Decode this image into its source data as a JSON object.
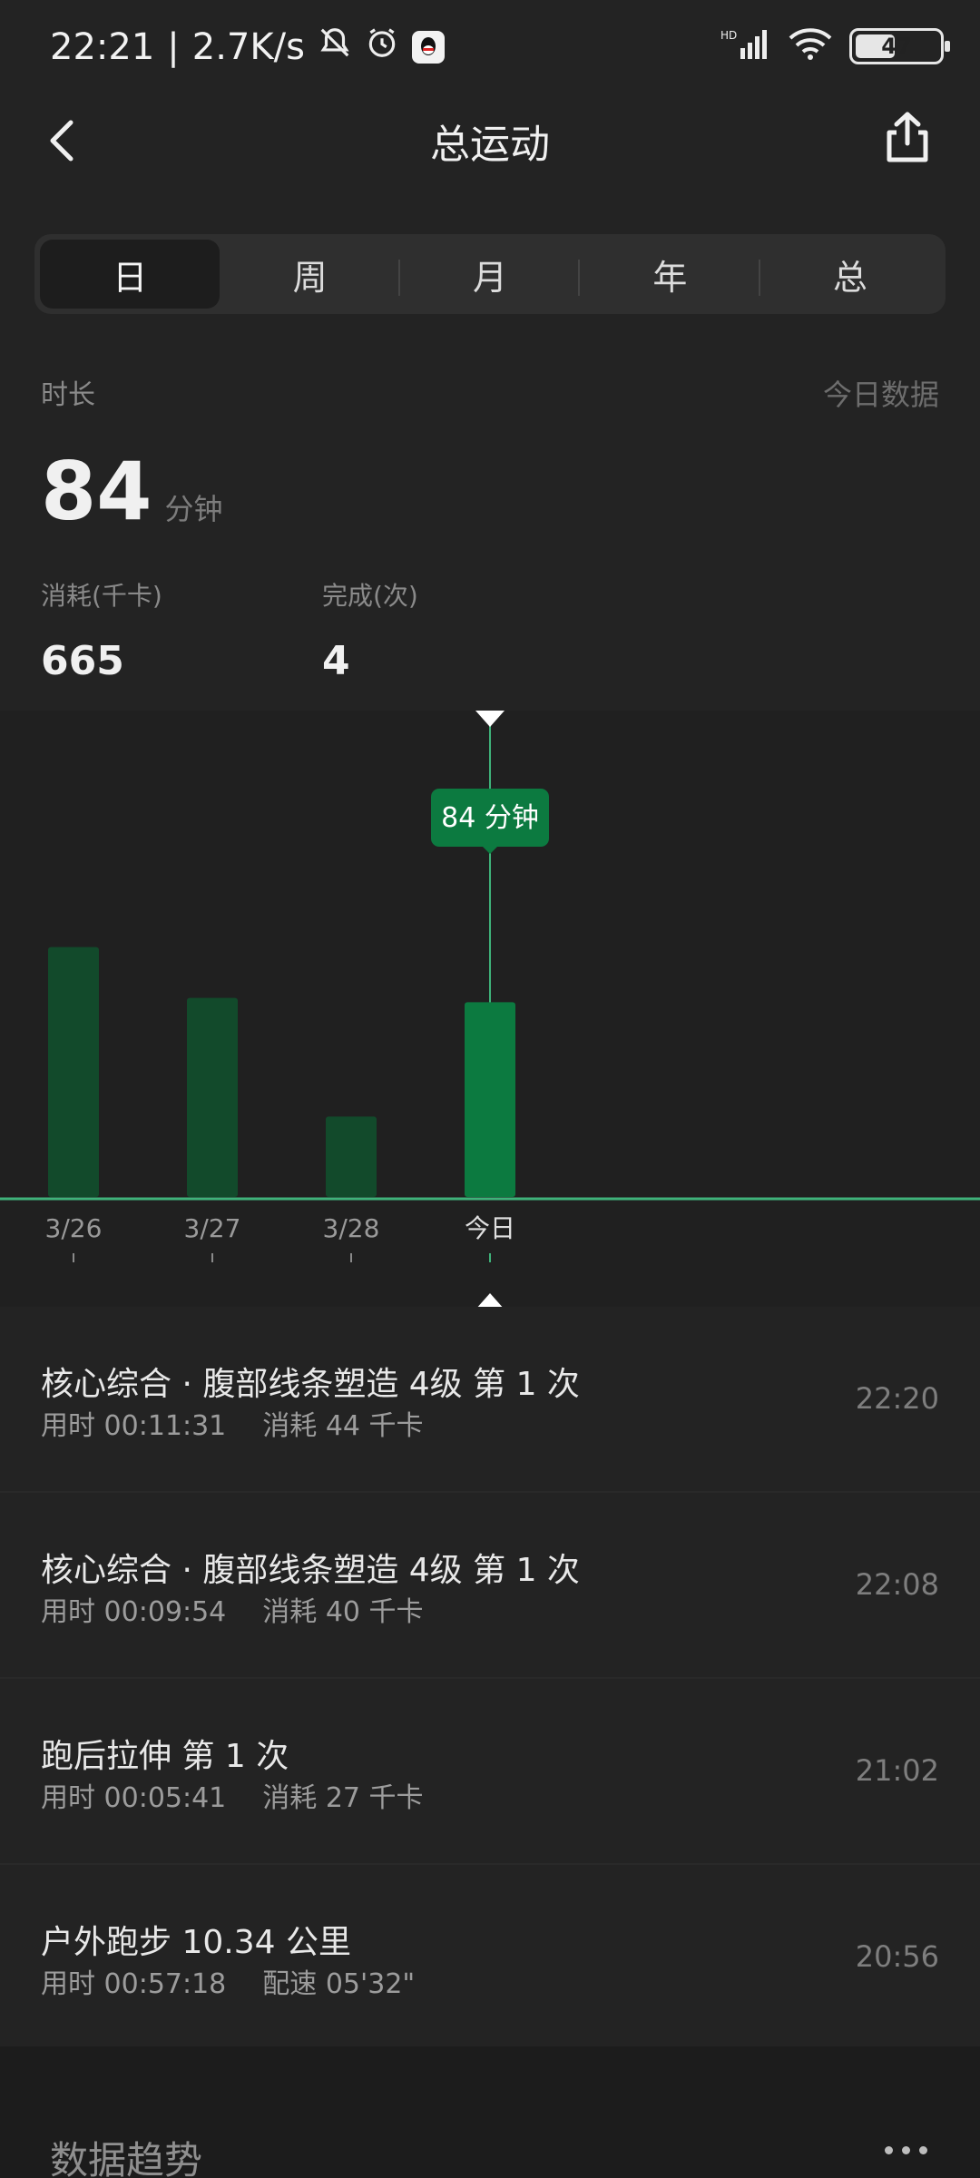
{
  "status": {
    "time": "22:21",
    "speed": "2.7K/s",
    "battery": "47"
  },
  "header": {
    "title": "总运动"
  },
  "tabs": [
    "日",
    "周",
    "月",
    "年",
    "总"
  ],
  "summary": {
    "duration_label": "时长",
    "today_label": "今日数据",
    "duration_value": "84",
    "duration_unit": "分钟",
    "calories_label": "消耗(千卡)",
    "calories_value": "665",
    "completed_label": "完成(次)",
    "completed_value": "4"
  },
  "chart_data": {
    "type": "bar",
    "categories": [
      "3/26",
      "3/27",
      "3/28",
      "今日"
    ],
    "values": [
      118,
      94,
      38,
      92
    ],
    "highlight_index": 3,
    "tooltip": "84 分钟",
    "colors": {
      "bar": "#124a2b",
      "bar_active": "#0c7a40",
      "tooltip": "#0c7a40",
      "baseline": "#3fb27a"
    }
  },
  "activities": [
    {
      "name": "核心综合 · 腹部线条塑造 4级 第 1 次",
      "used": "用时 00:11:31",
      "metric": "消耗 44 千卡",
      "time": "22:20"
    },
    {
      "name": "核心综合 · 腹部线条塑造 4级 第 1 次",
      "used": "用时 00:09:54",
      "metric": "消耗 40 千卡",
      "time": "22:08"
    },
    {
      "name": "跑后拉伸 第 1 次",
      "used": "用时 00:05:41",
      "metric": "消耗 27 千卡",
      "time": "21:02"
    },
    {
      "name": "户外跑步 10.34 公里",
      "used": "用时 00:57:18",
      "metric": "配速 05'32\"",
      "time": "20:56"
    }
  ],
  "trend": {
    "title": "数据趋势"
  }
}
